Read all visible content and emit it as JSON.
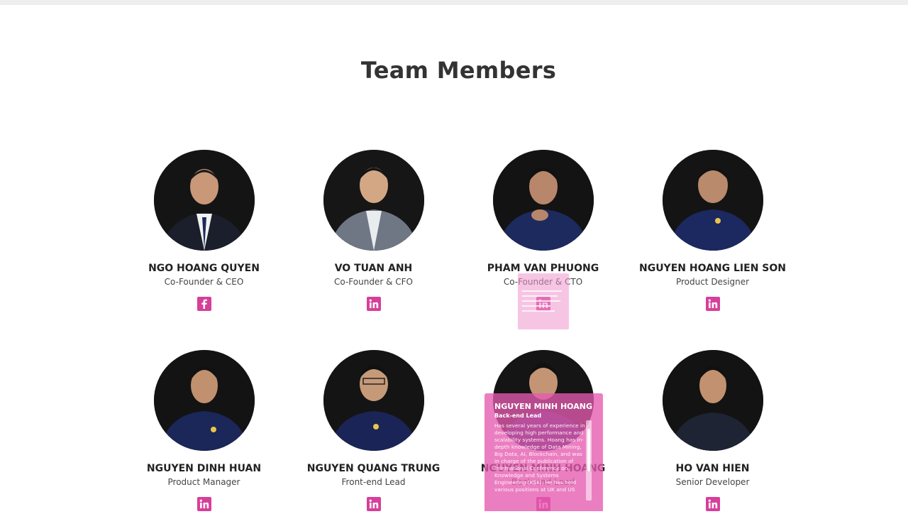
{
  "section": {
    "title": "Team Members"
  },
  "icons": {
    "facebook": "facebook-icon",
    "linkedin": "linkedin-icon"
  },
  "colors": {
    "accent": "#d63f9a",
    "popup": "#e65aaf",
    "avatar_bg": "#111111"
  },
  "members": [
    {
      "name": "NGO HOANG QUYEN",
      "role": "Co-Founder & CEO",
      "social": "facebook"
    },
    {
      "name": "VO TUAN ANH",
      "role": "Co-Founder & CFO",
      "social": "linkedin"
    },
    {
      "name": "PHAM VAN PHUONG",
      "role": "Co-Founder & CTO",
      "social": "linkedin"
    },
    {
      "name": "NGUYEN HOANG LIEN SON",
      "role": "Product Designer",
      "social": "linkedin"
    },
    {
      "name": "NGUYEN DINH HUAN",
      "role": "Product Manager",
      "social": "linkedin"
    },
    {
      "name": "NGUYEN QUANG TRUNG",
      "role": "Front-end Lead",
      "social": "linkedin"
    },
    {
      "name": "NGUYEN MINH HOANG",
      "role": "Back-end Lead",
      "social": "linkedin"
    },
    {
      "name": "HO VAN HIEN",
      "role": "Senior Developer",
      "social": "linkedin"
    }
  ],
  "popup": {
    "name": "NGUYEN MINH HOANG",
    "role": "Back-end Lead",
    "bio": "Has several years of experience in developing high performance and scalability systems. Hoang has in-depth knowledge of Data Mining, Big Data, AI, Blockchain, and was in charge of the publication of International Conference on Knowledge and Systems Engineering (KSE). He has held various positions at UK and US"
  }
}
